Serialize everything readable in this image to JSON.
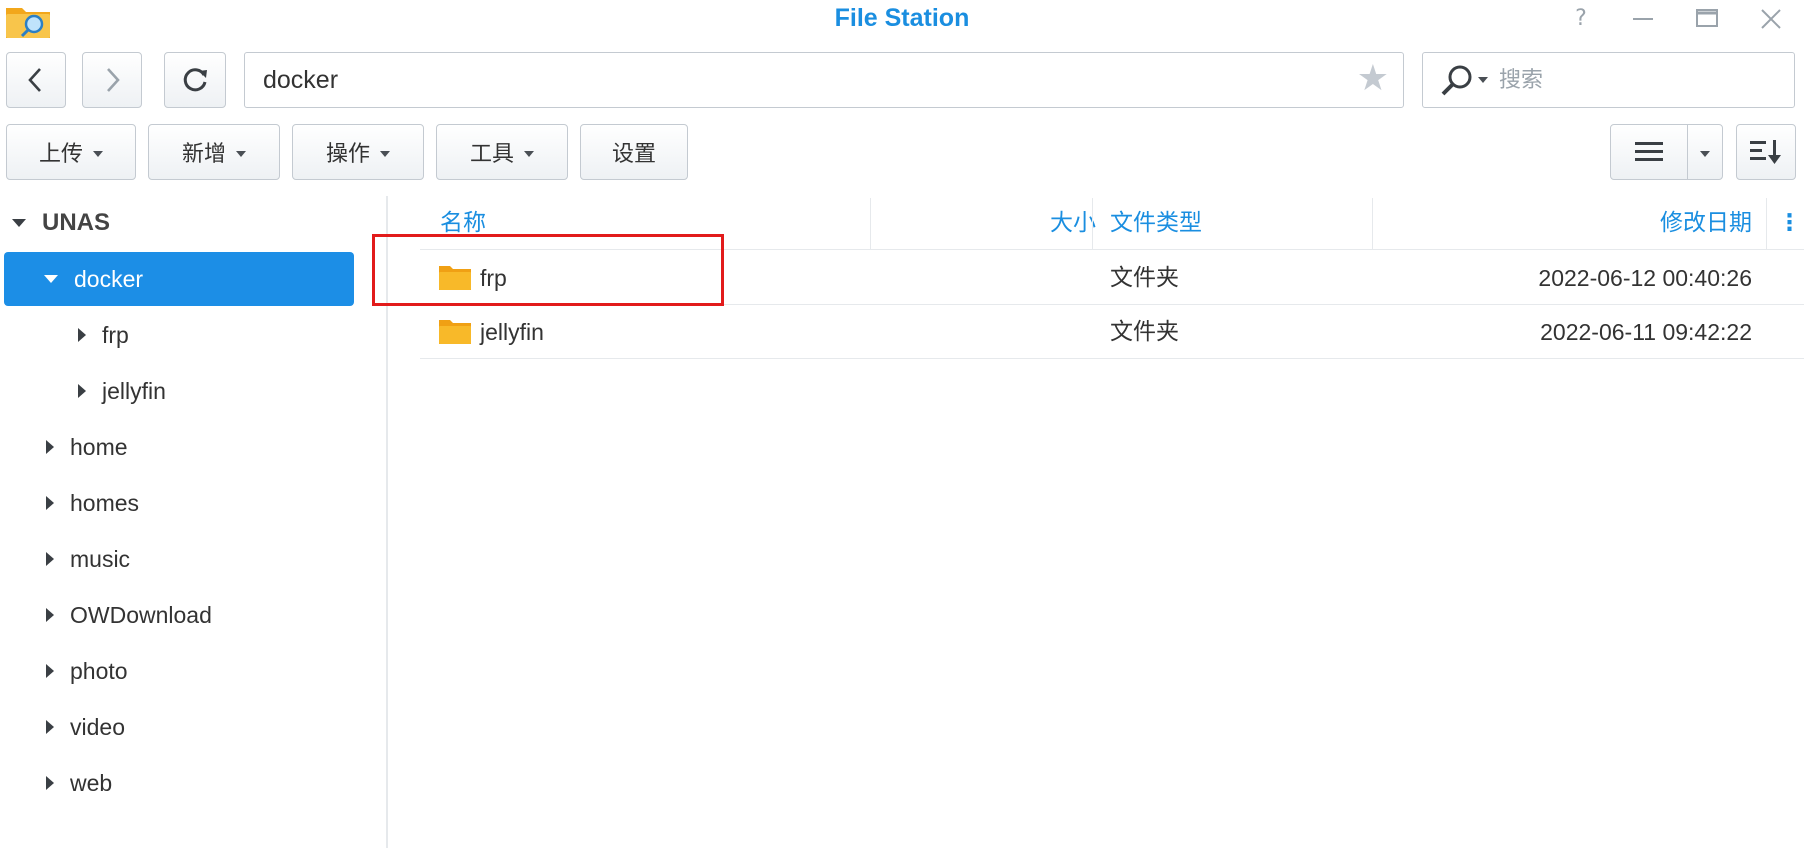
{
  "window": {
    "title": "File Station"
  },
  "address": {
    "path": "docker"
  },
  "search": {
    "placeholder": "搜索"
  },
  "toolbar": {
    "upload": "上传",
    "new": "新增",
    "action": "操作",
    "tools": "工具",
    "settings": "设置"
  },
  "tree": {
    "root": "UNAS",
    "items": [
      {
        "label": "docker"
      },
      {
        "label": "frp"
      },
      {
        "label": "jellyfin"
      },
      {
        "label": "home"
      },
      {
        "label": "homes"
      },
      {
        "label": "music"
      },
      {
        "label": "OWDownload"
      },
      {
        "label": "photo"
      },
      {
        "label": "video"
      },
      {
        "label": "web"
      }
    ]
  },
  "columns": {
    "name": "名称",
    "size": "大小",
    "type": "文件类型",
    "modified": "修改日期"
  },
  "files": [
    {
      "name": "frp",
      "type": "文件夹",
      "modified": "2022-06-12 00:40:26"
    },
    {
      "name": "jellyfin",
      "type": "文件夹",
      "modified": "2022-06-11 09:42:22"
    }
  ],
  "colors": {
    "accent": "#1a8ee0",
    "selected": "#1c8ee6",
    "highlight": "#e21b1b",
    "folder": "#f6b21b"
  }
}
